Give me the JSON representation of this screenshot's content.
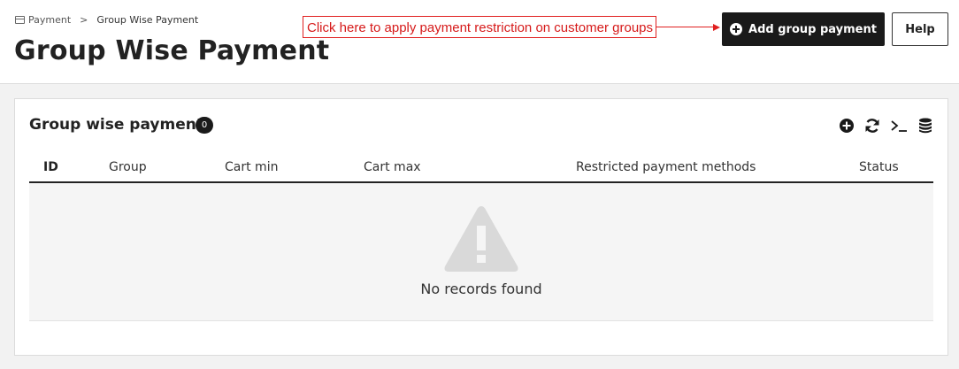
{
  "breadcrumb": {
    "root": "Payment",
    "separator": ">",
    "current": "Group Wise Payment"
  },
  "page_title": "Group Wise Payment",
  "annotation": {
    "text": "Click here to apply payment restriction on customer groups",
    "color": "#e02020"
  },
  "actions": {
    "add_label": "Add group payment",
    "help_label": "Help"
  },
  "panel": {
    "title": "Group wise payment",
    "count": "0",
    "toolbar_icons": [
      "add-circle-icon",
      "refresh-icon",
      "terminal-icon",
      "database-icon"
    ]
  },
  "table": {
    "columns": [
      "ID",
      "Group",
      "Cart min",
      "Cart max",
      "Restricted payment methods",
      "Status"
    ],
    "empty_message": "No records found"
  },
  "colors": {
    "primary": "#1a1a1a",
    "empty_bg": "#f5f5f5",
    "warning_icon": "#d9d9d9"
  }
}
